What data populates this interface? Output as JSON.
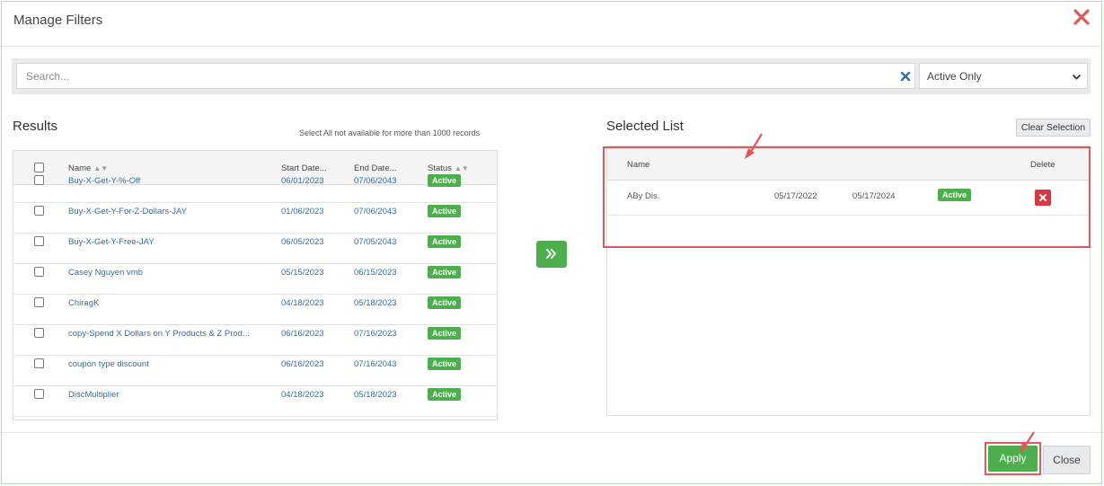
{
  "dialog": {
    "title": "Manage Filters"
  },
  "search": {
    "placeholder": "Search...",
    "status_filter": "Active Only"
  },
  "results": {
    "title": "Results",
    "hint": "Select All not available for more than 1000 records",
    "columns": {
      "name": "Name",
      "start": "Start Date...",
      "end": "End Date...",
      "status": "Status"
    },
    "rows": [
      {
        "name": "Buy-X-Get-Y-%-Off",
        "start": "06/01/2023",
        "end": "07/06/2043",
        "status": "Active"
      },
      {
        "name": "Buy-X-Get-Y-For-Z-Dollars-JAY",
        "start": "01/06/2023",
        "end": "07/06/2043",
        "status": "Active"
      },
      {
        "name": "Buy-X-Get-Y-Free-JAY",
        "start": "06/05/2023",
        "end": "07/05/2043",
        "status": "Active"
      },
      {
        "name": "Casey Nguyen vmb",
        "start": "05/15/2023",
        "end": "06/15/2023",
        "status": "Active"
      },
      {
        "name": "ChiragK",
        "start": "04/18/2023",
        "end": "05/18/2023",
        "status": "Active"
      },
      {
        "name": "copy-Spend X Dollars on Y Products & Z Prod...",
        "start": "06/16/2023",
        "end": "07/16/2023",
        "status": "Active"
      },
      {
        "name": "coupon type discount",
        "start": "06/16/2023",
        "end": "07/16/2043",
        "status": "Active"
      },
      {
        "name": "DiscMultiplier",
        "start": "04/18/2023",
        "end": "05/18/2023",
        "status": "Active"
      }
    ]
  },
  "selected": {
    "title": "Selected List",
    "clear_label": "Clear Selection",
    "columns": {
      "name": "Name",
      "delete": "Delete"
    },
    "rows": [
      {
        "name": "ABy Dis.",
        "start": "05/17/2022",
        "end": "05/17/2024",
        "status": "Active"
      }
    ]
  },
  "footer": {
    "apply_label": "Apply",
    "close_label": "Close"
  },
  "colors": {
    "accent_green": "#4cae4c",
    "link_blue": "#2f6fad",
    "danger_red": "#d9363e",
    "highlight": "#e0575c"
  }
}
